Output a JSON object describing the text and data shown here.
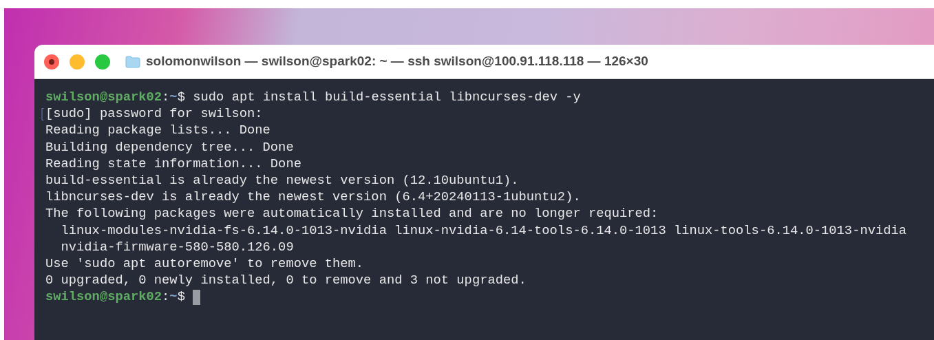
{
  "window": {
    "title": "solomonwilson — swilson@spark02: ~ — ssh swilson@100.91.118.118 — 126×30"
  },
  "terminal": {
    "lines": [
      {
        "kind": "prompt",
        "user_host": "swilson@spark02",
        "separator": ":",
        "path": "~",
        "symbol": "$",
        "command": "sudo apt install build-essential libncurses-dev -y",
        "cursor": false
      },
      {
        "kind": "output",
        "text": "[sudo] password for swilson:",
        "marked": true
      },
      {
        "kind": "output",
        "text": "Reading package lists... Done",
        "marked": false
      },
      {
        "kind": "output",
        "text": "Building dependency tree... Done",
        "marked": false
      },
      {
        "kind": "output",
        "text": "Reading state information... Done",
        "marked": false
      },
      {
        "kind": "output",
        "text": "build-essential is already the newest version (12.10ubuntu1).",
        "marked": false
      },
      {
        "kind": "output",
        "text": "libncurses-dev is already the newest version (6.4+20240113-1ubuntu2).",
        "marked": false
      },
      {
        "kind": "output",
        "text": "The following packages were automatically installed and are no longer required:",
        "marked": false
      },
      {
        "kind": "output",
        "text": "  linux-modules-nvidia-fs-6.14.0-1013-nvidia linux-nvidia-6.14-tools-6.14.0-1013 linux-tools-6.14.0-1013-nvidia",
        "marked": false
      },
      {
        "kind": "output",
        "text": "  nvidia-firmware-580-580.126.09",
        "marked": false
      },
      {
        "kind": "output",
        "text": "Use 'sudo apt autoremove' to remove them.",
        "marked": false
      },
      {
        "kind": "output",
        "text": "0 upgraded, 0 newly installed, 0 to remove and 3 not upgraded.",
        "marked": false
      },
      {
        "kind": "prompt",
        "user_host": "swilson@spark02",
        "separator": ":",
        "path": "~",
        "symbol": "$",
        "cursor": true
      }
    ]
  }
}
